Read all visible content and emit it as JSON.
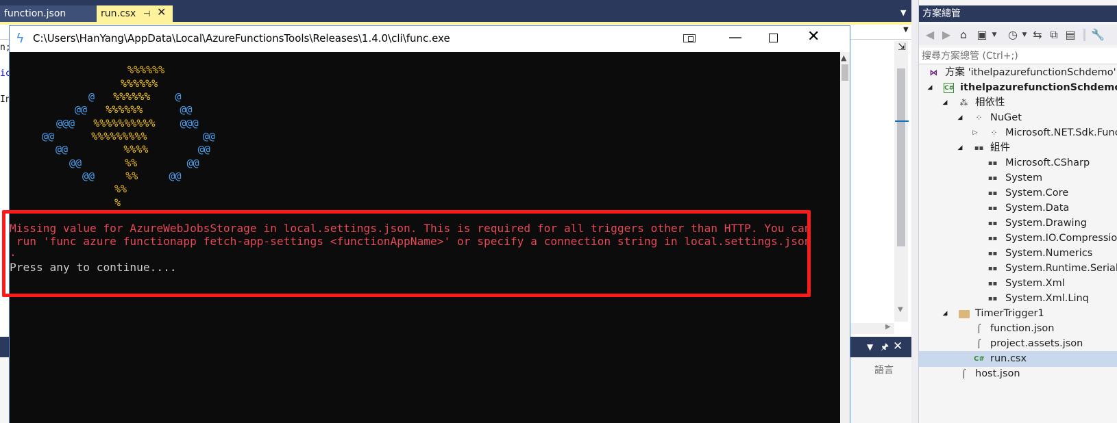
{
  "editor_tabs": [
    {
      "label": "function.json",
      "active": false
    },
    {
      "label": "run.csx",
      "active": true
    }
  ],
  "editor": {
    "code_fragments": [
      "n;",
      "ic",
      "In"
    ],
    "split_icon": "split-editor-icon"
  },
  "output_panel": {
    "language_label": "語言"
  },
  "solution_explorer": {
    "title": "方案總管",
    "search_placeholder": "搜尋方案總管 (Ctrl+;)",
    "toolbar_icons": [
      "back-icon",
      "forward-icon",
      "home-icon",
      "switch-views-icon",
      "pending-changes-icon",
      "sync-icon",
      "collapse-all-icon",
      "show-all-files-icon",
      "properties-icon"
    ],
    "tree": [
      {
        "label": "方案 'ithelpazurefunctionSchdemo' (",
        "icon": "solution-icon",
        "bold": false
      },
      {
        "label": "ithelpazurefunctionSchdemo",
        "icon": "csharp-project-icon",
        "bold": true
      },
      {
        "label": "相依性",
        "icon": "dependencies-icon",
        "bold": false
      },
      {
        "label": "NuGet",
        "icon": "nuget-icon",
        "bold": false
      },
      {
        "label": "Microsoft.NET.Sdk.Func",
        "icon": "package-icon",
        "bold": false
      },
      {
        "label": "組件",
        "icon": "assemblies-icon",
        "bold": false
      },
      {
        "label": "Microsoft.CSharp",
        "icon": "reference-icon",
        "bold": false
      },
      {
        "label": "System",
        "icon": "reference-icon",
        "bold": false
      },
      {
        "label": "System.Core",
        "icon": "reference-icon",
        "bold": false
      },
      {
        "label": "System.Data",
        "icon": "reference-icon",
        "bold": false
      },
      {
        "label": "System.Drawing",
        "icon": "reference-icon",
        "bold": false
      },
      {
        "label": "System.IO.Compression",
        "icon": "reference-icon",
        "bold": false
      },
      {
        "label": "System.Numerics",
        "icon": "reference-icon",
        "bold": false
      },
      {
        "label": "System.Runtime.Seriali",
        "icon": "reference-icon",
        "bold": false
      },
      {
        "label": "System.Xml",
        "icon": "reference-icon",
        "bold": false
      },
      {
        "label": "System.Xml.Linq",
        "icon": "reference-icon",
        "bold": false
      },
      {
        "label": "TimerTrigger1",
        "icon": "folder-icon",
        "bold": false
      },
      {
        "label": "function.json",
        "icon": "json-file-icon",
        "bold": false
      },
      {
        "label": "project.assets.json",
        "icon": "json-file-icon",
        "bold": false
      },
      {
        "label": "run.csx",
        "icon": "csharp-script-icon",
        "bold": false,
        "selected": true
      },
      {
        "label": "host.json",
        "icon": "json-file-icon",
        "bold": false
      }
    ]
  },
  "console": {
    "title": "C:\\Users\\HanYang\\AppData\\Local\\AzureFunctionsTools\\Releases\\1.4.0\\cli\\func.exe",
    "app_icon": "azure-functions-icon",
    "ascii_art": [
      {
        "blue_left": "",
        "yellow_a": "%%%",
        "yellow_b": "%%%",
        "blue_right": ""
      },
      {
        "blue_left": "",
        "yellow_a": "%%%",
        "yellow_b": "%%%",
        "blue_right": ""
      },
      {
        "blue_left": "@",
        "yellow_a": "%%%",
        "yellow_b": "%%%",
        "blue_right": "@"
      },
      {
        "blue_left": "@@",
        "yellow_a": "%%%",
        "yellow_b": "%%%",
        "blue_right": "@@"
      },
      {
        "blue_left": "@@@",
        "yellow_a": "%%%%%",
        "yellow_b": "%%%%%",
        "blue_right": "@@@"
      },
      {
        "blue_left": "@@",
        "yellow_a": "%%%%%%",
        "yellow_b": "%%%",
        "blue_right": "@@"
      },
      {
        "blue_left": "@@",
        "yellow_a": "%%",
        "yellow_b": "%%",
        "blue_right": "@@"
      },
      {
        "blue_left": "@@",
        "yellow_a": "%%",
        "yellow_b": "",
        "blue_right": "@@"
      },
      {
        "blue_left": "@@",
        "yellow_a": "%%",
        "yellow_b": "",
        "blue_right": "@@"
      },
      {
        "blue_left": "",
        "yellow_a": "%%",
        "yellow_b": "",
        "blue_right": ""
      },
      {
        "blue_left": "",
        "yellow_a": "%",
        "yellow_b": "",
        "blue_right": ""
      }
    ],
    "error_lines": [
      "Missing value for AzureWebJobsStorage in local.settings.json. This is required for all triggers other than HTTP. You can",
      " run 'func azure functionapp fetch-app-settings <functionAppName>' or specify a connection string in local.settings.json",
      "."
    ],
    "prompt_line": "Press any to continue...."
  },
  "colors": {
    "vs_header": "#2b3a5c",
    "active_tab": "#fff29d",
    "console_bg": "#0c0c0c",
    "error_text": "#e74856",
    "highlight_box": "#ff1a1a",
    "art_blue": "#4aa0f0",
    "art_yellow": "#f0c020"
  }
}
